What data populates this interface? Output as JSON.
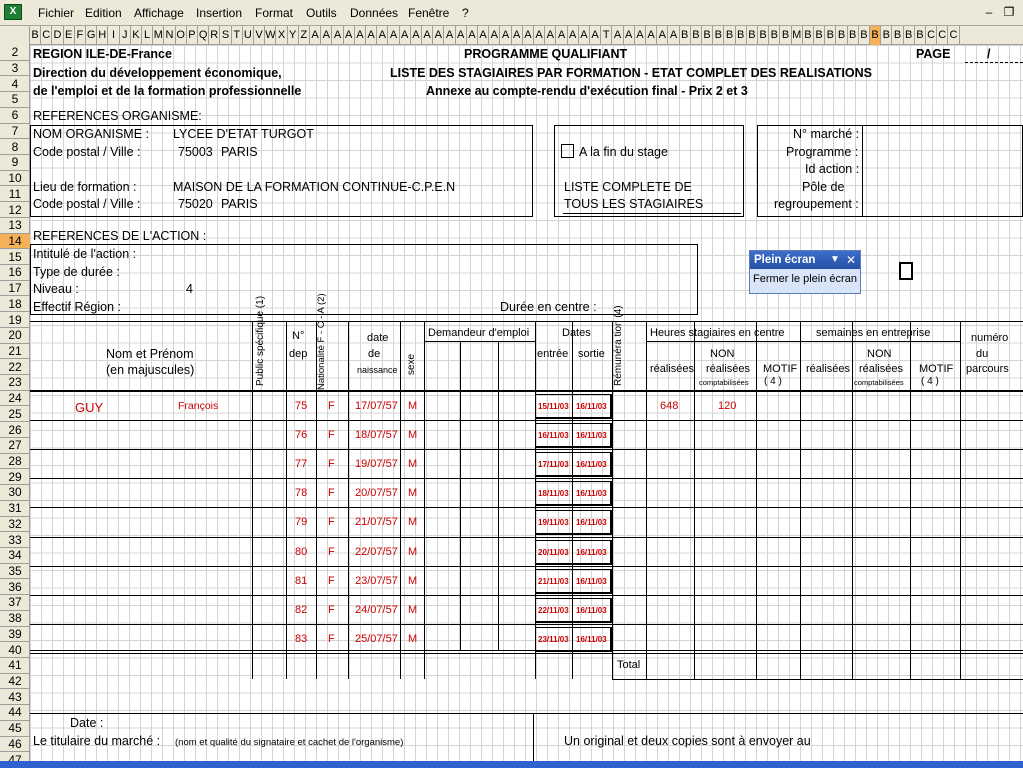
{
  "menu": {
    "app_icon": "excel-icon",
    "items": [
      "Fichier",
      "Edition",
      "Affichage",
      "Insertion",
      "Format",
      "Outils",
      "Données",
      "Fenêtre",
      "?"
    ],
    "min_symbol": "–",
    "restore_symbol": "❐"
  },
  "columns": [
    "B",
    "C",
    "D",
    "E",
    "F",
    "G",
    "H",
    "I",
    "J",
    "K",
    "L",
    "M",
    "N",
    "O",
    "P",
    "Q",
    "R",
    "S",
    "T",
    "U",
    "V",
    "W",
    "X",
    "Y",
    "Z",
    "A",
    "A",
    "A",
    "A",
    "A",
    "A",
    "A",
    "A",
    "A",
    "A",
    "A",
    "A",
    "A",
    "A",
    "A",
    "A",
    "A",
    "A",
    "A",
    "A",
    "A",
    "A",
    "A",
    "A",
    "A",
    "A",
    "T",
    "A",
    "A",
    "A",
    "A",
    "A",
    "A",
    "B",
    "B",
    "B",
    "B",
    "B",
    "B",
    "B",
    "B",
    "B",
    "B",
    "M",
    "B",
    "B",
    "B",
    "B",
    "B",
    "B",
    "B",
    "B",
    "B",
    "B",
    "B",
    "C",
    "C",
    "C"
  ],
  "selected_column_index": 75,
  "rows": [
    "2",
    "3",
    "4",
    "5",
    "6",
    "7",
    "8",
    "9",
    "10",
    "11",
    "12",
    "13",
    "14",
    "15",
    "16",
    "17",
    "18",
    "19",
    "20",
    "21",
    "22",
    "23",
    "24",
    "25",
    "26",
    "27",
    "28",
    "29",
    "30",
    "31",
    "32",
    "33",
    "34",
    "35",
    "36",
    "37",
    "38",
    "39",
    "40",
    "41",
    "42",
    "43",
    "44",
    "45",
    "46",
    "47"
  ],
  "selected_row": "14",
  "header": {
    "region": "REGION ILE-DE-France",
    "programme": "PROGRAMME QUALIFIANT",
    "page_label": "PAGE",
    "page_slash": "/",
    "direction": "Direction du développement économique,",
    "liste": "LISTE DES STAGIAIRES PAR FORMATION - ETAT COMPLET DES REALISATIONS",
    "emploi": "de l'emploi et de la formation professionnelle",
    "annexe": "Annexe au compte-rendu d'exécution final - Prix 2 et 3"
  },
  "org": {
    "title": "REFERENCES ORGANISME:",
    "nom_label": "NOM ORGANISME :",
    "nom_value": "LYCEE D'ETAT TURGOT",
    "cp_label": "Code postal /  Ville :",
    "cp_value": "75003",
    "ville_value": "PARIS",
    "lieu_label": "Lieu de formation :",
    "lieu_value": "MAISON DE LA FORMATION CONTINUE-C.P.E.N",
    "cp2_label": "Code postal /  Ville :",
    "cp2_value": "75020",
    "ville2_value": "PARIS",
    "fin_stage": "A la fin du stage",
    "liste_complete_1": "LISTE COMPLETE DE",
    "liste_complete_2": "TOUS LES STAGIAIRES",
    "marche": "N° marché :",
    "programme": "Programme :",
    "id_action": "Id action :",
    "pole": "Pôle de",
    "regroupement": "regroupement :"
  },
  "action": {
    "title": "REFERENCES DE L'ACTION :",
    "intitule": "Intitulé de l'action :",
    "type_duree": "Type de durée :",
    "niveau": "Niveau :",
    "niveau_value": "4",
    "effectif": "Effectif Région :",
    "duree_centre": "Durée en centre :"
  },
  "table": {
    "nom_prenom": "Nom et Prénom",
    "majuscules": "(en majuscules)",
    "public": "Public spécifique (1)",
    "no": "N°",
    "dep": "dep",
    "nationalite": "Nationalité F - C - A (2)",
    "date": "date",
    "de": "de",
    "naissance": "naissance",
    "sexe": "sexe",
    "demandeur": "Demandeur d'emploi",
    "dates": "Dates",
    "entree": "entrée",
    "sortie": "sortie",
    "remuneration": "Rémunéra tion (4)",
    "heures_centre": "Heures stagiaires en centre",
    "realisees": "réalisées",
    "non": "NON",
    "non_realisees": "réalisées",
    "comptabilisees": "comptabilisées",
    "motif": "MOTIF",
    "motif_code": "( 4 )",
    "semaines": "semaines en entreprise",
    "realisees2": "réalisées",
    "non2": "NON",
    "non_realisees2": "réalisées",
    "comptabilisees2": "comptabilisées",
    "motif2": "MOTIF",
    "motif_code2": "( 4 )",
    "numero": "numéro",
    "du": "du",
    "parcours": "parcours",
    "total": "Total"
  },
  "trainees": [
    {
      "nom": "GUY",
      "prenom": "François",
      "dep": "75",
      "nat": "F",
      "naissance": "17/07/57",
      "sexe": "M",
      "entree": "15/11/03",
      "sortie": "16/11/03",
      "heures": "648",
      "non_compt": "120"
    },
    {
      "nom": "",
      "prenom": "",
      "dep": "76",
      "nat": "F",
      "naissance": "18/07/57",
      "sexe": "M",
      "entree": "16/11/03",
      "sortie": "16/11/03",
      "heures": "",
      "non_compt": ""
    },
    {
      "nom": "",
      "prenom": "",
      "dep": "77",
      "nat": "F",
      "naissance": "19/07/57",
      "sexe": "M",
      "entree": "17/11/03",
      "sortie": "16/11/03",
      "heures": "",
      "non_compt": ""
    },
    {
      "nom": "",
      "prenom": "",
      "dep": "78",
      "nat": "F",
      "naissance": "20/07/57",
      "sexe": "M",
      "entree": "18/11/03",
      "sortie": "16/11/03",
      "heures": "",
      "non_compt": ""
    },
    {
      "nom": "",
      "prenom": "",
      "dep": "79",
      "nat": "F",
      "naissance": "21/07/57",
      "sexe": "M",
      "entree": "19/11/03",
      "sortie": "16/11/03",
      "heures": "",
      "non_compt": ""
    },
    {
      "nom": "",
      "prenom": "",
      "dep": "80",
      "nat": "F",
      "naissance": "22/07/57",
      "sexe": "M",
      "entree": "20/11/03",
      "sortie": "16/11/03",
      "heures": "",
      "non_compt": ""
    },
    {
      "nom": "",
      "prenom": "",
      "dep": "81",
      "nat": "F",
      "naissance": "23/07/57",
      "sexe": "M",
      "entree": "21/11/03",
      "sortie": "16/11/03",
      "heures": "",
      "non_compt": ""
    },
    {
      "nom": "",
      "prenom": "",
      "dep": "82",
      "nat": "F",
      "naissance": "24/07/57",
      "sexe": "M",
      "entree": "22/11/03",
      "sortie": "16/11/03",
      "heures": "",
      "non_compt": ""
    },
    {
      "nom": "",
      "prenom": "",
      "dep": "83",
      "nat": "F",
      "naissance": "25/07/57",
      "sexe": "M",
      "entree": "23/11/03",
      "sortie": "16/11/03",
      "heures": "",
      "non_compt": ""
    }
  ],
  "footer": {
    "date_label": "Date :",
    "titulaire": "Le titulaire du marché :",
    "titulaire_note": "(nom et qualité du signataire et cachet de l'organisme)",
    "original": "Un original et deux copies sont à envoyer au"
  },
  "fullscreen": {
    "title": "Plein écran",
    "dropdown_symbol": "▼",
    "close_symbol": "✕",
    "button": "Fermer le plein écran"
  },
  "colors": {
    "accent_red": "#cc0000",
    "selection": "#f5b15a",
    "panel_header": "#2350a6"
  }
}
